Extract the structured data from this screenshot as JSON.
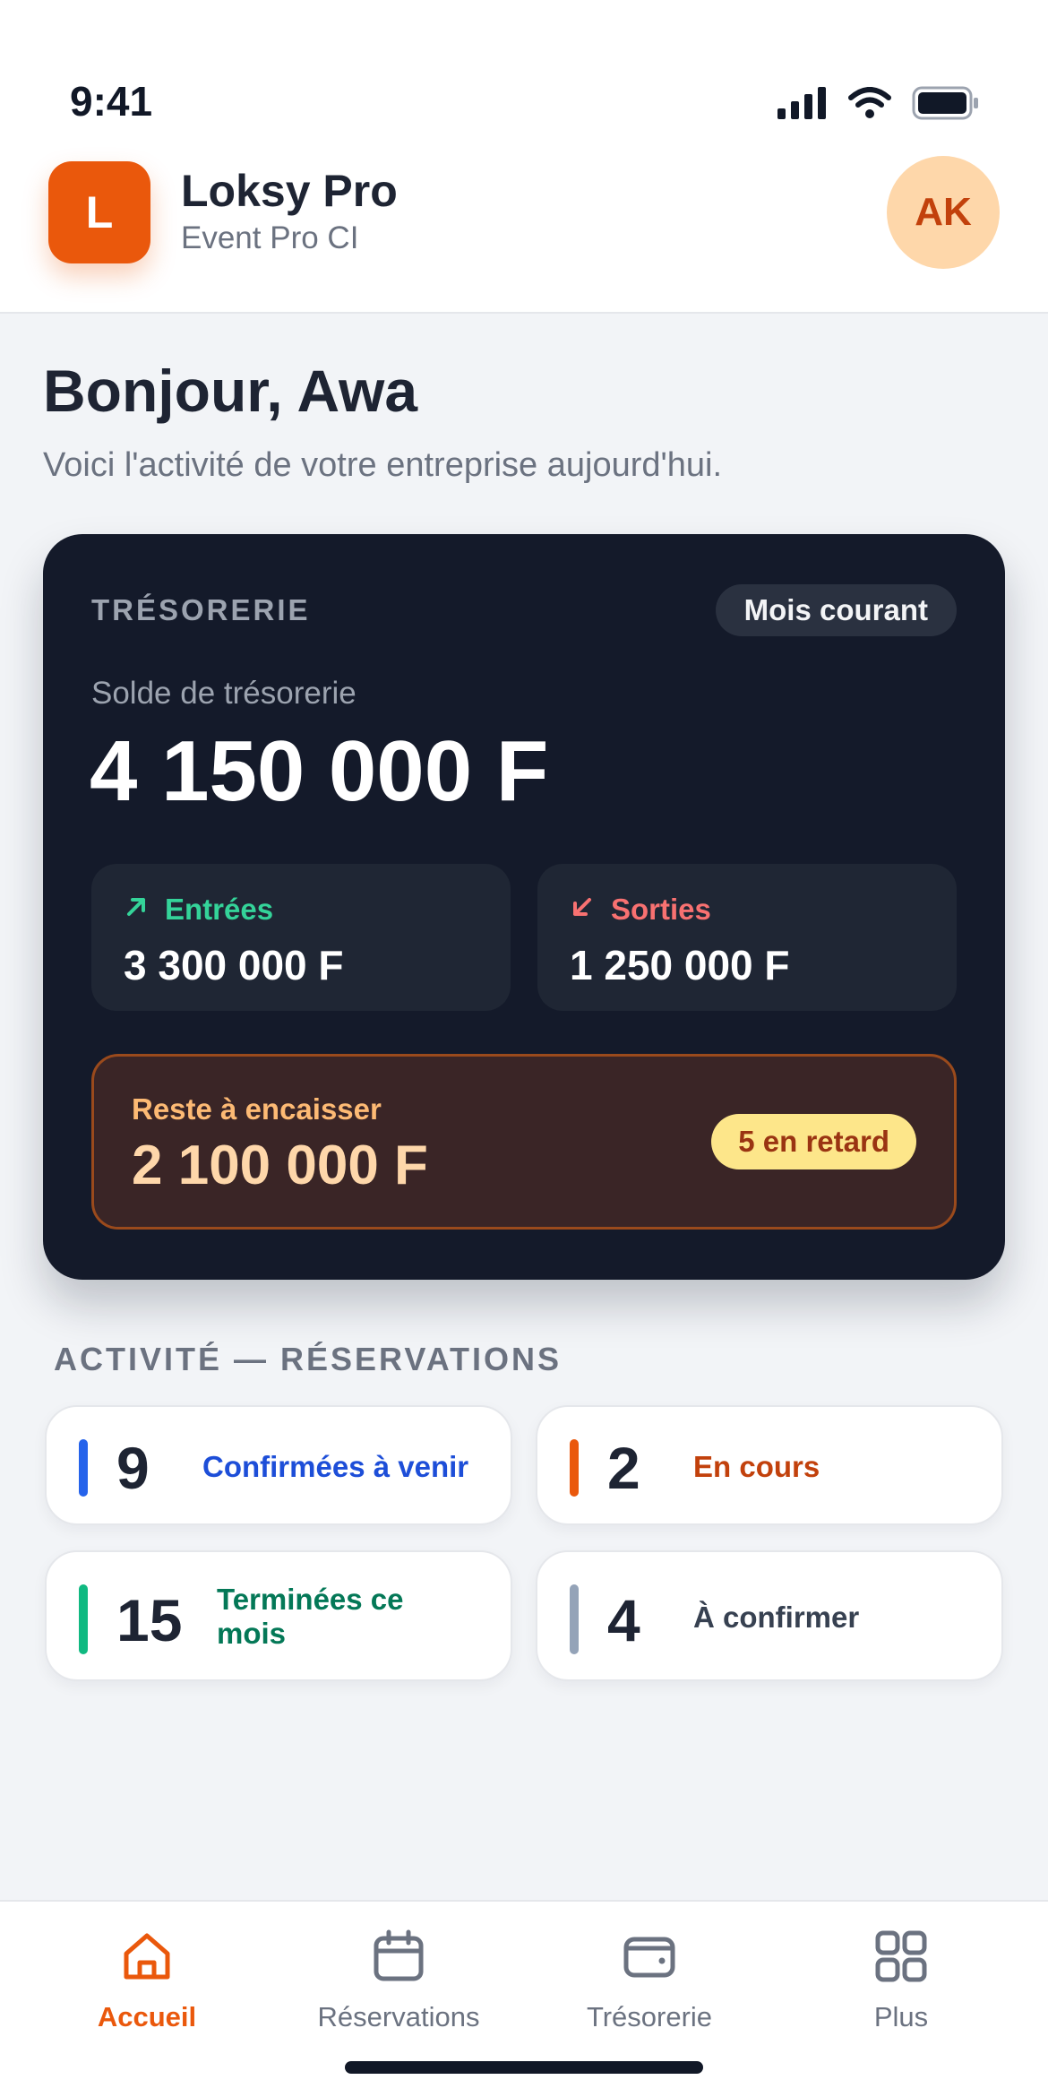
{
  "status_bar": {
    "time": "9:41"
  },
  "header": {
    "logo_letter": "L",
    "app_name": "Loksy Pro",
    "company": "Event Pro CI",
    "avatar_initials": "AK"
  },
  "greeting": {
    "title": "Bonjour, Awa",
    "subtitle": "Voici l'activité de votre entreprise aujourd'hui."
  },
  "treasury": {
    "label": "TRÉSORERIE",
    "period": "Mois courant",
    "balance_label": "Solde de trésorerie",
    "balance_value": "4 150 000 F",
    "inflows": {
      "label": "Entrées",
      "value": "3 300 000 F",
      "color": "#34d399",
      "icon": "arrow-up-right-icon"
    },
    "outflows": {
      "label": "Sorties",
      "value": "1 250 000 F",
      "color": "#f87171",
      "icon": "arrow-down-left-icon"
    },
    "to_collect": {
      "label": "Reste à encaisser",
      "value": "2 100 000 F",
      "late_badge": "5 en retard"
    }
  },
  "activity": {
    "title": "ACTIVITÉ — RÉSERVATIONS",
    "cards": [
      {
        "count": "9",
        "label": "Confirmées à venir",
        "color": "#2563eb"
      },
      {
        "count": "2",
        "label": "En cours",
        "color": "#ea580c"
      },
      {
        "count": "15",
        "label": "Terminées ce mois",
        "color": "#10b981"
      },
      {
        "count": "4",
        "label": "À confirmer",
        "color": "#94a3b8"
      }
    ]
  },
  "tabbar": {
    "items": [
      {
        "label": "Accueil",
        "icon": "home-icon",
        "active": true
      },
      {
        "label": "Réservations",
        "icon": "calendar-icon",
        "active": false
      },
      {
        "label": "Trésorerie",
        "icon": "wallet-icon",
        "active": false
      },
      {
        "label": "Plus",
        "icon": "grid-icon",
        "active": false
      }
    ]
  },
  "colors": {
    "accent": "#ea580c",
    "card_dark": "#141a2a",
    "background": "#f2f4f7"
  }
}
